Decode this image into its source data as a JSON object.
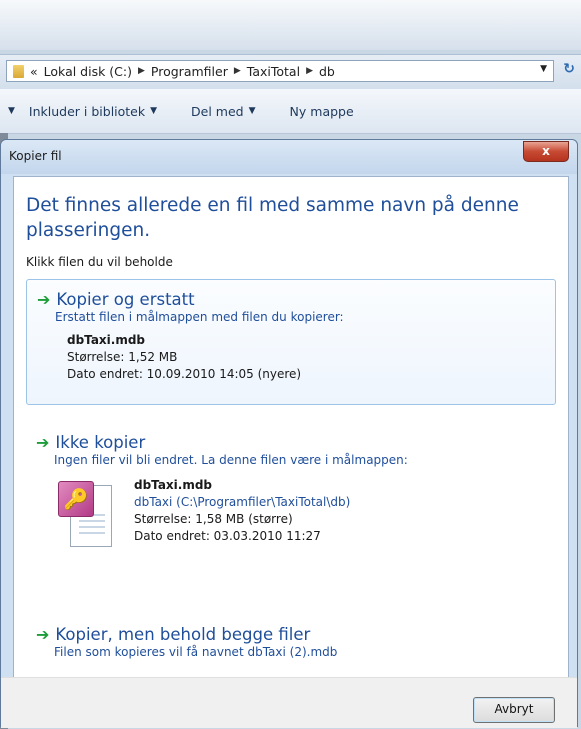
{
  "explorer": {
    "breadcrumb_prefix": "«",
    "breadcrumb": [
      "Lokal disk (C:)",
      "Programfiler",
      "TaxiTotal",
      "db"
    ],
    "toolbar": [
      {
        "label": "Inkluder i bibliotek",
        "has_dropdown": true
      },
      {
        "label": "Del med",
        "has_dropdown": true
      },
      {
        "label": "Ny mappe",
        "has_dropdown": false
      }
    ]
  },
  "dialog": {
    "title": "Kopier fil",
    "close_label": "x",
    "main_instruction": "Det finnes allerede en fil med samme navn på denne plasseringen.",
    "sub_instruction": "Klikk filen du vil beholde",
    "options": [
      {
        "title": "Kopier og erstatt",
        "description": "Erstatt filen i målmappen med filen du kopierer:",
        "file_name": "dbTaxi.mdb",
        "size": "Størrelse: 1,52 MB",
        "modified": "Dato endret: 10.09.2010 14:05 (nyere)"
      },
      {
        "title": "Ikke kopier",
        "description": "Ingen filer vil bli endret. La denne filen være i målmappen:",
        "file_name": "dbTaxi.mdb",
        "path": "dbTaxi (C:\\Programfiler\\TaxiTotal\\db)",
        "size": "Størrelse: 1,58 MB (større)",
        "modified": "Dato endret: 03.03.2010 11:27"
      },
      {
        "title": "Kopier, men behold begge filer",
        "description": "Filen som kopieres vil få navnet dbTaxi (2).mdb"
      }
    ],
    "cancel_label": "Avbryt"
  },
  "colors": {
    "instruction_blue": "#1f4e9a",
    "arrow_green": "#1f9d3a",
    "close_red": "#c74a33"
  }
}
